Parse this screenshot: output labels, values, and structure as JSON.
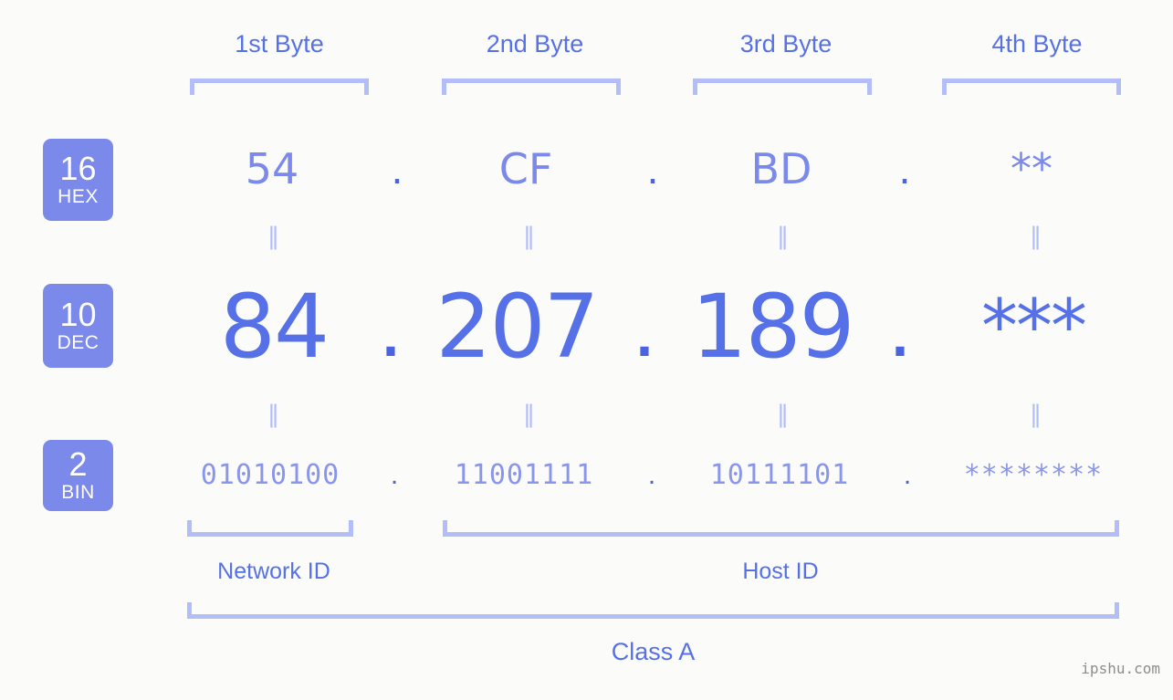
{
  "watermark": "ipshu.com",
  "byte_headers": [
    {
      "label": "1st Byte"
    },
    {
      "label": "2nd Byte"
    },
    {
      "label": "3rd Byte"
    },
    {
      "label": "4th Byte"
    }
  ],
  "rows": {
    "hex": {
      "base": "16",
      "abbr": "HEX",
      "values": [
        "54",
        "CF",
        "BD",
        "**"
      ],
      "separator": "."
    },
    "dec": {
      "base": "10",
      "abbr": "DEC",
      "values": [
        "84",
        "207",
        "189",
        "***"
      ],
      "separator": "."
    },
    "bin": {
      "base": "2",
      "abbr": "BIN",
      "values": [
        "01010100",
        "11001111",
        "10111101",
        "********"
      ],
      "separator": "."
    }
  },
  "equals_marks": {
    "hex_to_dec": [
      "‖",
      "‖",
      "‖",
      "‖"
    ],
    "dec_to_bin": [
      "‖",
      "‖",
      "‖",
      "‖"
    ]
  },
  "sections": [
    {
      "label": "Network ID"
    },
    {
      "label": "Host ID"
    }
  ],
  "class_label": "Class A",
  "colors": {
    "background": "#fbfcfa",
    "accent_strong": "#5670e8",
    "accent_mid": "#7b8aea",
    "accent_light": "#8a96ea",
    "bracket": "#b3bdf7",
    "badge_bg": "#7b8aea",
    "badge_text": "#ffffff",
    "dot": "#4a63e0",
    "watermark": "#8d8d8d"
  }
}
